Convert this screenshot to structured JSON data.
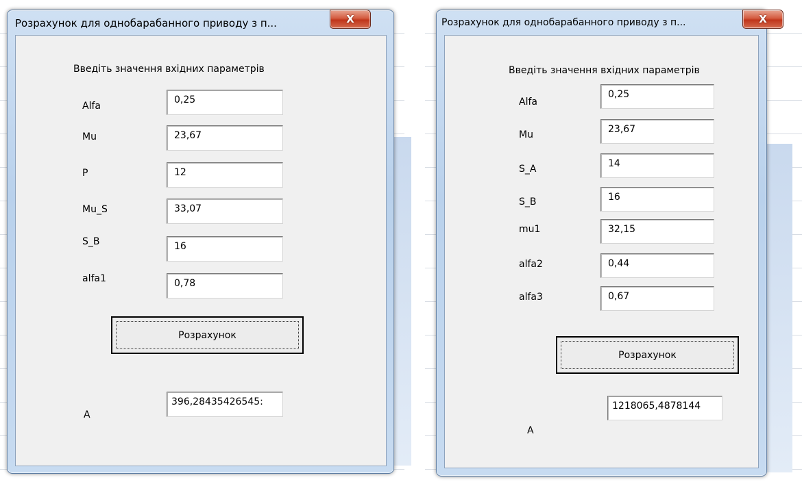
{
  "windows": [
    {
      "title": "Розрахунок для однобарабанного приводу з п...",
      "close_label": "X",
      "heading": "Введіть значення вхідних параметрів",
      "params": [
        {
          "label": "Alfa",
          "value": "0,25"
        },
        {
          "label": "Mu",
          "value": "23,67"
        },
        {
          "label": "P",
          "value": "12"
        },
        {
          "label": "Mu_S",
          "value": "33,07"
        },
        {
          "label": "S_B",
          "value": "16"
        },
        {
          "label": "alfa1",
          "value": "0,78"
        }
      ],
      "button_label": "Розрахунок",
      "result_label": "A",
      "result_value": "396,28435426545:"
    },
    {
      "title": "Розрахунок для однобарабанного приводу з п...",
      "close_label": "X",
      "heading": "Введіть значення вхідних параметрів",
      "params": [
        {
          "label": "Alfa",
          "value": "0,25"
        },
        {
          "label": "Mu",
          "value": "23,67"
        },
        {
          "label": "S_A",
          "value": "14"
        },
        {
          "label": "S_B",
          "value": "16"
        },
        {
          "label": "mu1",
          "value": "32,15"
        },
        {
          "label": "alfa2",
          "value": "0,44"
        },
        {
          "label": "alfa3",
          "value": "0,67"
        }
      ],
      "button_label": "Розрахунок",
      "result_label": "A",
      "result_value": "1218065,4878144"
    }
  ]
}
